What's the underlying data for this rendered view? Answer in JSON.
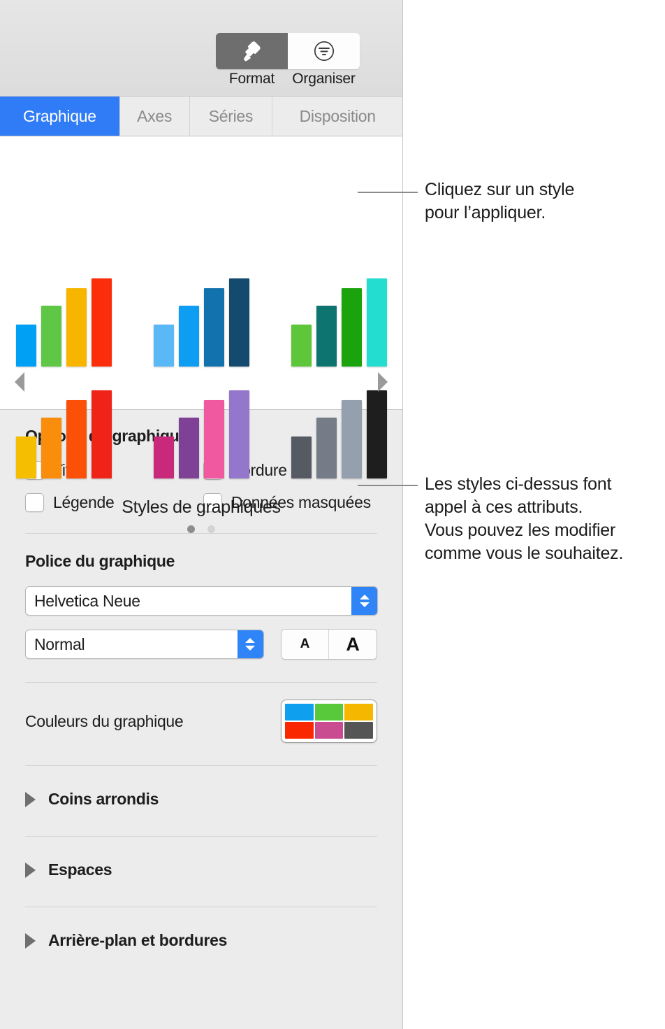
{
  "toolbar": {
    "buttons": [
      {
        "label": "Format",
        "icon": "paintbrush-icon",
        "active": true
      },
      {
        "label": "Organiser",
        "icon": "arrange-filter-icon",
        "active": false
      }
    ]
  },
  "tabs": [
    {
      "label": "Graphique",
      "active": true
    },
    {
      "label": "Axes",
      "active": false
    },
    {
      "label": "Séries",
      "active": false
    },
    {
      "label": "Disposition",
      "active": false
    }
  ],
  "gallery": {
    "title": "Styles de graphiques",
    "prev_arrow": "left-triangle-icon",
    "next_arrow": "right-triangle-icon",
    "page_dots": [
      true,
      false
    ],
    "styles": [
      {
        "name": "style-1-blue-green-yellow-red",
        "colors": [
          "#00A0F5",
          "#5EC745",
          "#F7B500",
          "#FC2D0A"
        ],
        "heights": [
          60,
          87,
          112,
          126
        ]
      },
      {
        "name": "style-2-blues",
        "colors": [
          "#5BB8F7",
          "#0D9DF2",
          "#1272AE",
          "#134A6E"
        ],
        "heights": [
          60,
          87,
          112,
          126
        ]
      },
      {
        "name": "style-3-greens",
        "colors": [
          "#5EC63A",
          "#0D7470",
          "#1BA30D",
          "#22DDD0"
        ],
        "heights": [
          60,
          87,
          112,
          126
        ]
      },
      {
        "name": "style-4-warm",
        "colors": [
          "#F5BE00",
          "#FA8E0C",
          "#FA5008",
          "#EF2318"
        ],
        "heights": [
          60,
          87,
          112,
          126
        ]
      },
      {
        "name": "style-5-pink-purple",
        "colors": [
          "#C9297A",
          "#7F4195",
          "#F0599F",
          "#9476CD"
        ],
        "heights": [
          60,
          87,
          112,
          126
        ]
      },
      {
        "name": "style-6-grays",
        "colors": [
          "#555A63",
          "#757C88",
          "#94A0AE",
          "#1E1E1E"
        ],
        "heights": [
          60,
          87,
          112,
          126
        ]
      }
    ]
  },
  "chart_options": {
    "title": "Options du graphique",
    "checkboxes": [
      {
        "label": "Titre",
        "checked": false
      },
      {
        "label": "Bordure",
        "checked": false
      },
      {
        "label": "Légende",
        "checked": false
      },
      {
        "label": "Données masquées",
        "checked": false
      }
    ]
  },
  "chart_font": {
    "title": "Police du graphique",
    "family_value": "Helvetica Neue",
    "style_value": "Normal",
    "size_small_label": "A",
    "size_large_label": "A"
  },
  "chart_colors": {
    "label": "Couleurs du graphique",
    "swatches": [
      "#0E9FEE",
      "#58C93A",
      "#F5B700",
      "#FA2800",
      "#C84C8F",
      "#555555"
    ]
  },
  "disclosures": [
    {
      "label": "Coins arrondis"
    },
    {
      "label": "Espaces"
    },
    {
      "label": "Arrière-plan et bordures"
    }
  ],
  "callouts": [
    {
      "name": "callout-styles",
      "text": "Cliquez sur un style\npour l’appliquer."
    },
    {
      "name": "callout-attributes",
      "text": "Les styles ci-dessus font\nappel à ces attributs.\nVous pouvez les modifier\ncomme vous le souhaitez."
    }
  ],
  "accent_color": "#2F7CF6"
}
